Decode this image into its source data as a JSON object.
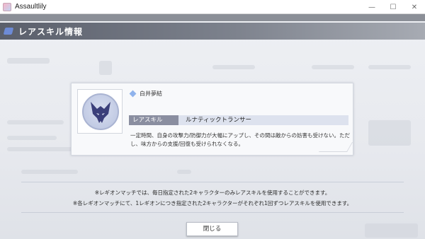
{
  "window": {
    "title": "Assaultlily",
    "controls": {
      "minimize": "—",
      "maximize": "☐",
      "close": "✕"
    }
  },
  "header": {
    "title": "レアスキル情報"
  },
  "skill_card": {
    "character": "白井夢結",
    "skill_label": "レアスキル",
    "skill_name": "ルナティックトランサー",
    "description": "一定時間、自身の攻撃力/防御力が大幅にアップし、その間は敵からの妨害も受けない。ただし、味方からの支援/回復も受けられなくなる。",
    "icon": "demon-emblem-icon"
  },
  "notes": [
    "※レギオンマッチでは、毎日指定された2キャラクターのみレアスキルを使用することができます。",
    "※各レギオンマッチにて、1レギオンにつき指定された2キャラクターがそれぞれ1回ずつレアスキルを使用できます。"
  ],
  "close_button": "閉じる",
  "colors": {
    "header": "#5a5f6b",
    "accent": "#6d8bd6",
    "skill_label_bg": "#8a8ea0",
    "skill_name_bg": "#dde2ee"
  }
}
